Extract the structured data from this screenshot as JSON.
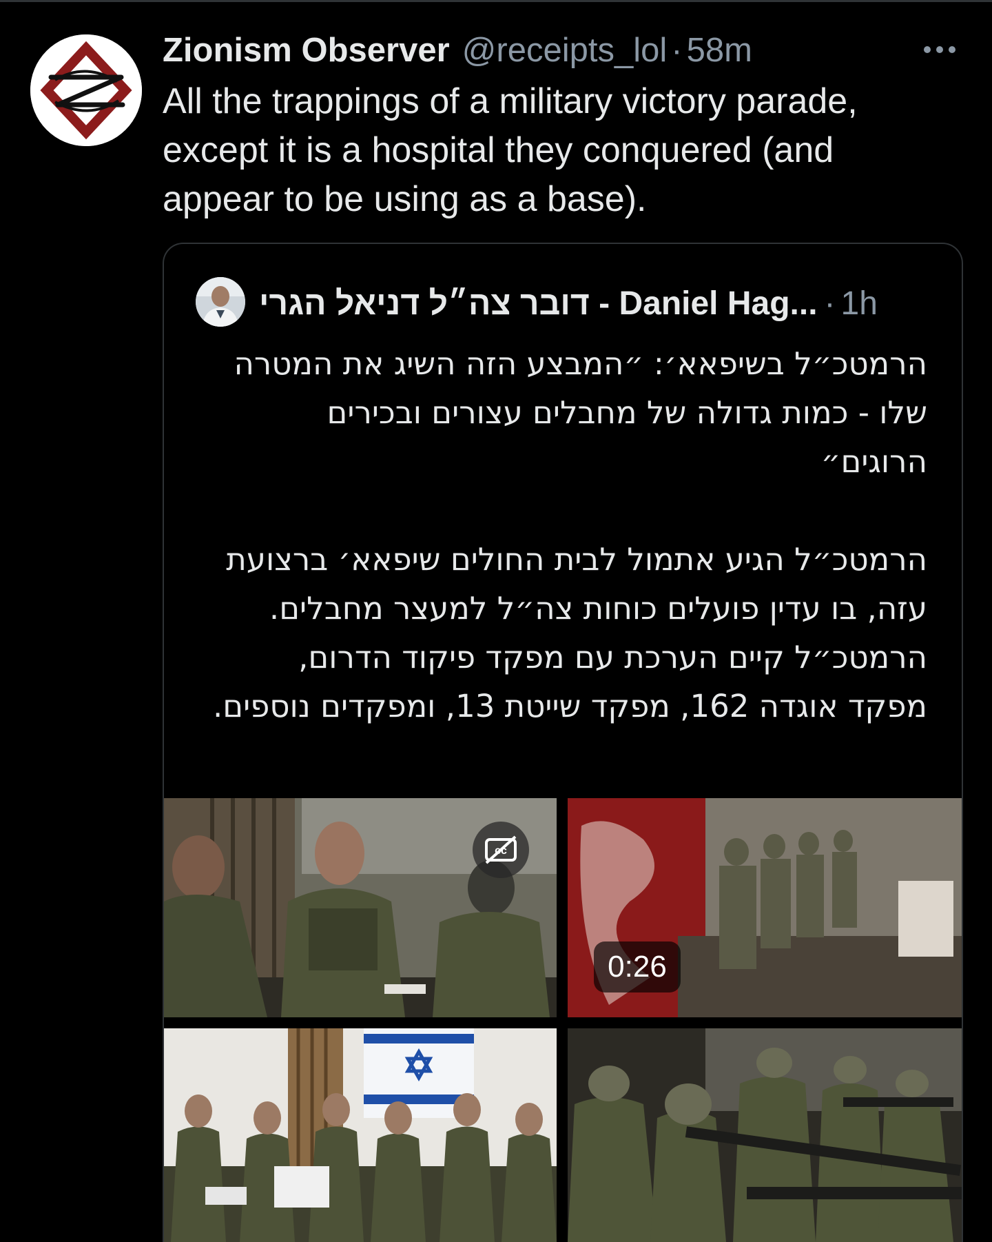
{
  "tweet": {
    "display_name": "Zionism Observer",
    "handle": "@receipts_lol",
    "separator": "·",
    "time": "58m",
    "text": "All the trappings of a military victory parade, except it is a hospital they conquered (and appear to be using as a base).",
    "more_icon": "more-horizontal-icon"
  },
  "quoted_tweet": {
    "display_name": "דובר צה״ל דניאל הגרי - Daniel Hag...",
    "separator": "·",
    "time": "1h",
    "paragraphs": [
      "הרמטכ״ל בשיפאא׳: ״המבצע הזה השיג את המטרה שלו - כמות גדולה של מחבלים עצורים ובכירים הרוגים״",
      "הרמטכ״ל הגיע אתמול לבית החולים שיפאא׳ ברצועת עזה, בו עדין פועלים כוחות צה״ל למעצר מחבלים. הרמטכ״ל קיים הערכת עם מפקד פיקוד הדרום, מפקד אוגדה 162, מפקד שייטת 13, ומפקדים נוספים."
    ],
    "media": {
      "video_duration": "0:26",
      "cc_icon": "closed-captions-off-icon"
    }
  },
  "colors": {
    "background": "#000000",
    "text_primary": "#e7e9ea",
    "text_secondary": "#8b98a5",
    "border": "#2f3336",
    "avatar_logo_red": "#8c1c1c"
  }
}
